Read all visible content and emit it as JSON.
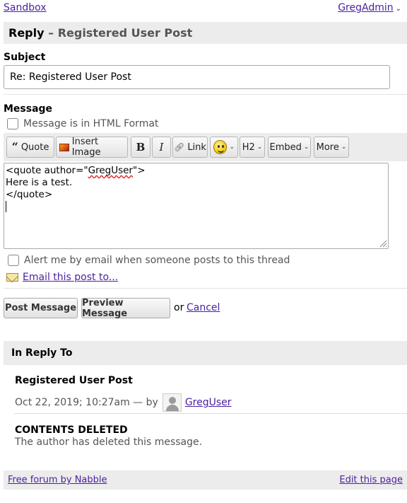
{
  "topbar": {
    "forum_link": "Sandbox",
    "user_menu": "GregAdmin"
  },
  "header": {
    "title": "Reply",
    "separator": " – ",
    "subtitle": "Registered User Post"
  },
  "subject": {
    "label": "Subject",
    "value": "Re: Registered User Post"
  },
  "message": {
    "label": "Message",
    "html_format_label": "Message is in HTML Format",
    "body_line1_pre": "<quote author=\"",
    "body_line1_user": "GregUser",
    "body_line1_post": "\">",
    "body_line2": "Here is a test.",
    "body_line3": "</quote>"
  },
  "toolbar": {
    "quote": "Quote",
    "insert_image": "Insert Image",
    "bold": "B",
    "italic": "I",
    "link": "Link",
    "heading": "H2",
    "embed": "Embed",
    "more": "More"
  },
  "alert_label": "Alert me by email when someone posts to this thread",
  "email_post_link": "Email this post to...",
  "actions": {
    "post": "Post Message",
    "preview": "Preview Message",
    "or": "or",
    "cancel": "Cancel"
  },
  "in_reply_to": {
    "heading": "In Reply To",
    "post_title": "Registered User Post",
    "meta": "Oct 22, 2019; 10:27am — by",
    "author": "GregUser",
    "deleted_title": "CONTENTS DELETED",
    "deleted_text": "The author has deleted this message."
  },
  "footer": {
    "left": "Free forum by Nabble",
    "right": "Edit this page"
  }
}
